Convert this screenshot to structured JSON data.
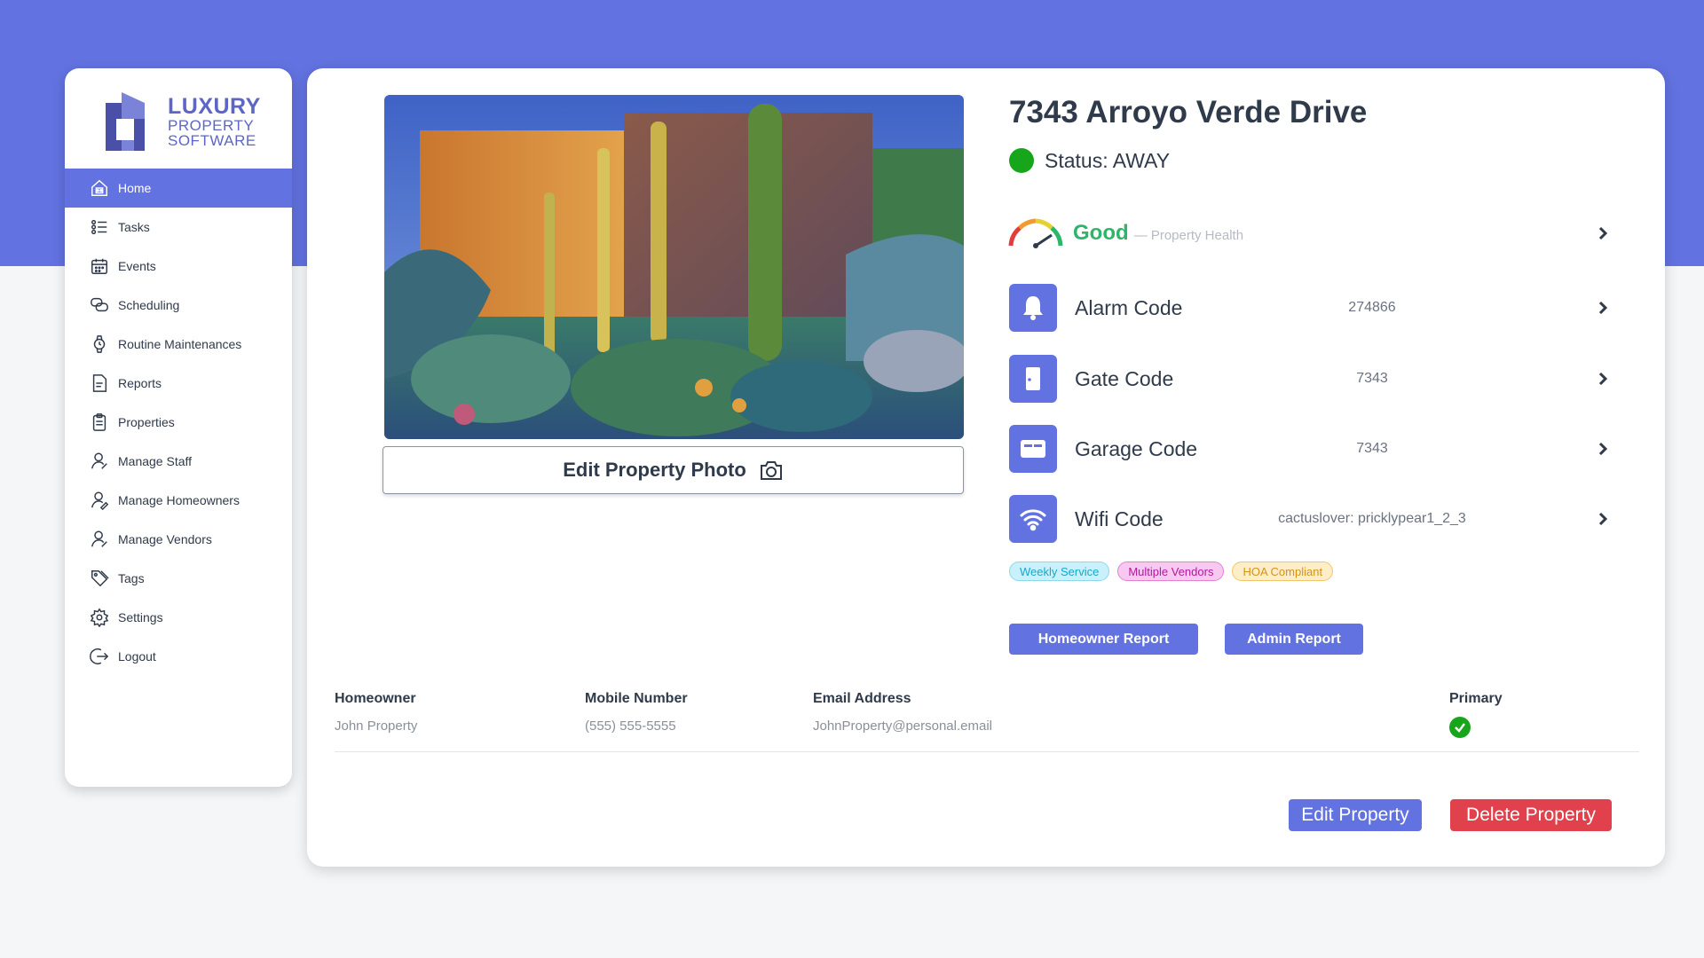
{
  "brand": {
    "line1": "LUXURY",
    "line2": "PROPERTY",
    "line3": "SOFTWARE",
    "colors": {
      "primary": "#6272e0",
      "danger": "#e0414c",
      "success": "#17a51c"
    }
  },
  "sidebar": {
    "items": [
      {
        "label": "Home",
        "icon": "home-icon",
        "active": true
      },
      {
        "label": "Tasks",
        "icon": "tasks-icon"
      },
      {
        "label": "Events",
        "icon": "calendar-icon"
      },
      {
        "label": "Scheduling",
        "icon": "chat-bubbles-icon"
      },
      {
        "label": "Routine Maintenances",
        "icon": "watch-icon"
      },
      {
        "label": "Reports",
        "icon": "report-icon"
      },
      {
        "label": "Properties",
        "icon": "clipboard-icon"
      },
      {
        "label": "Manage Staff",
        "icon": "person-icon"
      },
      {
        "label": "Manage Homeowners",
        "icon": "person-edit-icon"
      },
      {
        "label": "Manage Vendors",
        "icon": "person-icon"
      },
      {
        "label": "Tags",
        "icon": "tag-icon"
      },
      {
        "label": "Settings",
        "icon": "gear-icon"
      },
      {
        "label": "Logout",
        "icon": "logout-icon"
      }
    ]
  },
  "property": {
    "title": "7343 Arroyo Verde Drive",
    "status": "Status: AWAY",
    "edit_photo_label": "Edit Property Photo",
    "health": {
      "rating": "Good",
      "label": "— Property Health"
    },
    "codes": [
      {
        "label": "Alarm Code",
        "value": "274866",
        "icon": "bell-icon"
      },
      {
        "label": "Gate Code",
        "value": "7343",
        "icon": "door-icon"
      },
      {
        "label": "Garage Code",
        "value": "7343",
        "icon": "garage-icon"
      },
      {
        "label": "Wifi Code",
        "value": "cactuslover: pricklypear1_2_3",
        "icon": "wifi-icon"
      }
    ],
    "tags": [
      "Weekly Service",
      "Multiple Vendors",
      "HOA Compliant"
    ],
    "reports": {
      "homeowner": "Homeowner Report",
      "admin": "Admin Report"
    }
  },
  "homeowners_table": {
    "headers": [
      "Homeowner",
      "Mobile Number",
      "Email Address",
      "Primary"
    ],
    "rows": [
      {
        "name": "John Property",
        "mobile": "(555) 555-5555",
        "email": "JohnProperty@personal.email",
        "primary": true
      }
    ]
  },
  "actions": {
    "edit": "Edit Property",
    "delete": "Delete Property"
  }
}
